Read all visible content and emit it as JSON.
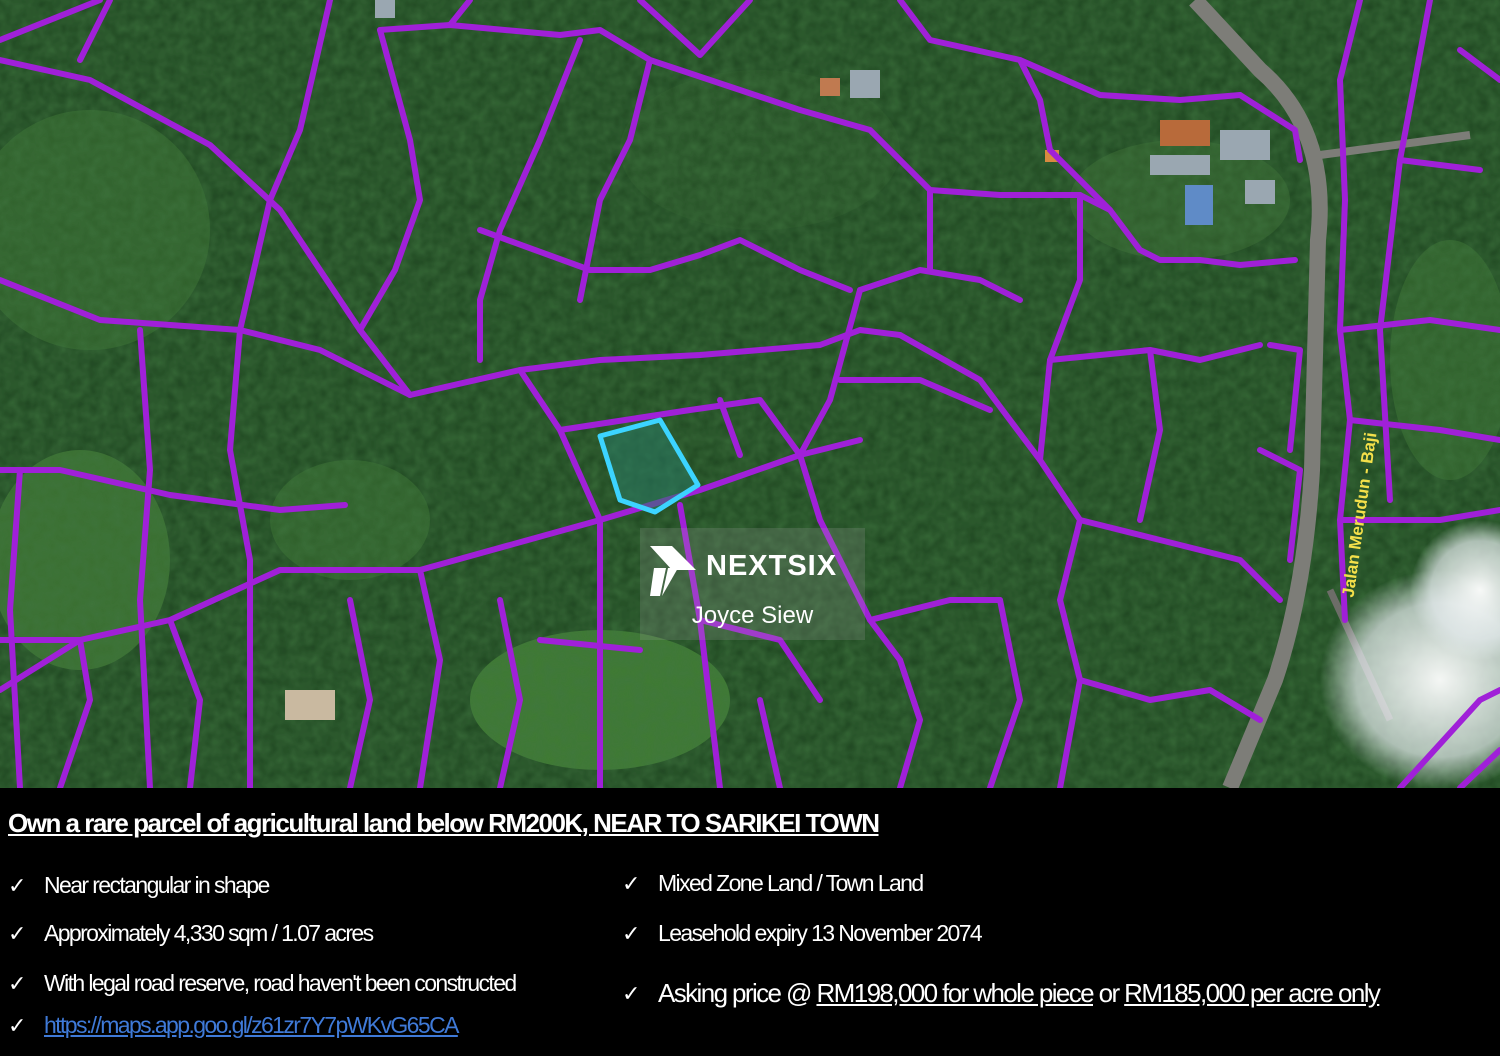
{
  "map": {
    "road_label": "Jalan Merudun - Baji",
    "colors": {
      "lot_line": "#a020d8",
      "highlight": "#3cd4ff",
      "forest": "#1e4520",
      "clearing": "#3f7a32",
      "road": "#7d7d78"
    }
  },
  "watermark": {
    "brand": "NEXTSIX",
    "agent": "Joyce Siew",
    "logo_icon": "nextsix-logo-icon"
  },
  "listing": {
    "headline": "Own a rare parcel of agricultural land below RM200K, NEAR TO SARIKEI TOWN",
    "check_symbol": "✓",
    "left_features": [
      "Near rectangular in shape",
      "Approximately 4,330 sqm  / 1.07 acres",
      "With legal road reserve, road haven't been constructed"
    ],
    "link": "https://maps.app.goo.gl/z61zr7Y7pWKvG65CA",
    "right_features": [
      "Mixed Zone Land / Town Land",
      "Leasehold expiry 13 November 2074"
    ],
    "price": {
      "prefix": "Asking price @",
      "whole": "RM198,000 for whole piece",
      "or": "or",
      "per_acre": "RM185,000 per acre only"
    }
  }
}
